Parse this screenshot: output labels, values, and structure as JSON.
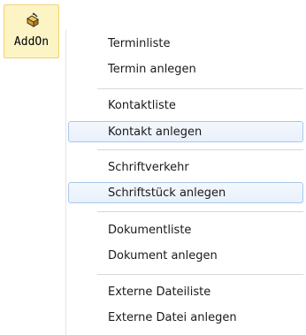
{
  "ribbon": {
    "addon_button": {
      "label": "AddOn",
      "icon": "addon-tool-icon"
    }
  },
  "menu": {
    "items": [
      {
        "label": "Terminliste",
        "state": "normal"
      },
      {
        "label": "Termin anlegen",
        "state": "normal"
      },
      {
        "label": "Kontaktliste",
        "state": "normal"
      },
      {
        "label": "Kontakt anlegen",
        "state": "hover"
      },
      {
        "label": "Schriftverkehr",
        "state": "normal"
      },
      {
        "label": "Schriftstück anlegen",
        "state": "hover"
      },
      {
        "label": "Dokumentliste",
        "state": "normal"
      },
      {
        "label": "Dokument anlegen",
        "state": "normal"
      },
      {
        "label": "Externe Dateiliste",
        "state": "normal"
      },
      {
        "label": "Externe Datei anlegen",
        "state": "normal"
      }
    ]
  }
}
